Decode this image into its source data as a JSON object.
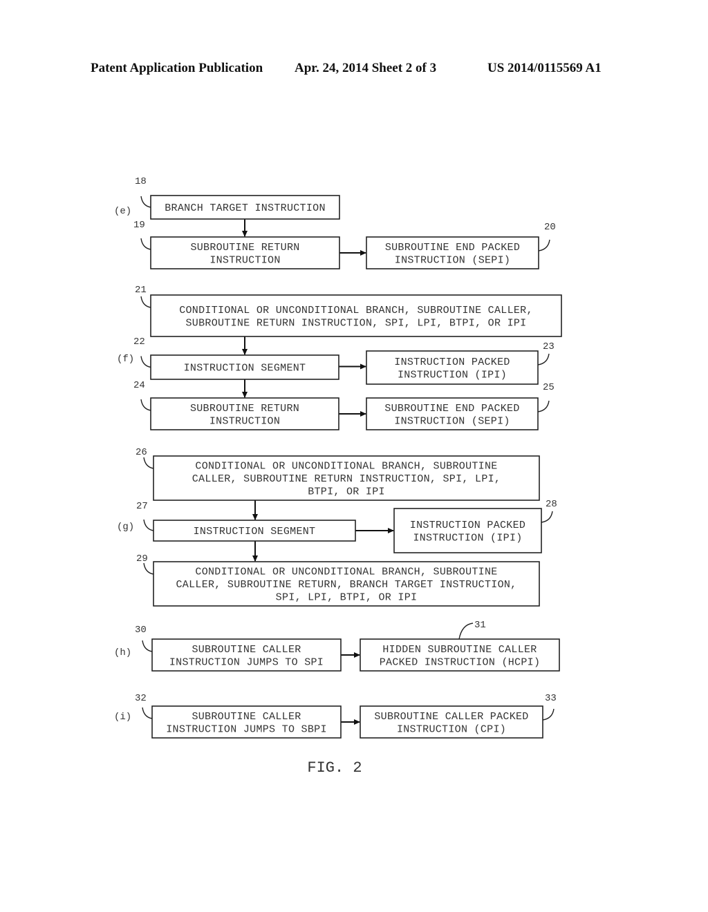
{
  "header": {
    "left": "Patent Application Publication",
    "center": "Apr. 24, 2014  Sheet 2 of 3",
    "right": "US 2014/0115569 A1"
  },
  "figure_caption": "FIG. 2",
  "sections": [
    {
      "label": "(e)"
    },
    {
      "label": "(f)"
    },
    {
      "label": "(g)"
    },
    {
      "label": "(h)"
    },
    {
      "label": "(i)"
    }
  ],
  "boxes": [
    {
      "ref": "18",
      "lines": [
        "BRANCH TARGET INSTRUCTION"
      ]
    },
    {
      "ref": "19",
      "lines": [
        "SUBROUTINE RETURN",
        "INSTRUCTION"
      ]
    },
    {
      "ref": "20",
      "lines": [
        "SUBROUTINE END PACKED",
        "INSTRUCTION (SEPI)"
      ]
    },
    {
      "ref": "21",
      "lines": [
        "CONDITIONAL OR UNCONDITIONAL BRANCH, SUBROUTINE CALLER,",
        "SUBROUTINE RETURN INSTRUCTION, SPI, LPI, BTPI, OR IPI"
      ]
    },
    {
      "ref": "22",
      "lines": [
        "INSTRUCTION SEGMENT"
      ]
    },
    {
      "ref": "23",
      "lines": [
        "INSTRUCTION PACKED",
        "INSTRUCTION (IPI)"
      ]
    },
    {
      "ref": "24",
      "lines": [
        "SUBROUTINE RETURN",
        "INSTRUCTION"
      ]
    },
    {
      "ref": "25",
      "lines": [
        "SUBROUTINE END PACKED",
        "INSTRUCTION (SEPI)"
      ]
    },
    {
      "ref": "26",
      "lines": [
        "CONDITIONAL OR UNCONDITIONAL BRANCH, SUBROUTINE",
        "CALLER, SUBROUTINE RETURN INSTRUCTION, SPI, LPI,",
        "BTPI, OR IPI"
      ]
    },
    {
      "ref": "27",
      "lines": [
        "INSTRUCTION SEGMENT"
      ]
    },
    {
      "ref": "28",
      "lines": [
        "INSTRUCTION PACKED",
        "INSTRUCTION (IPI)"
      ]
    },
    {
      "ref": "29",
      "lines": [
        "CONDITIONAL OR UNCONDITIONAL BRANCH, SUBROUTINE",
        "CALLER, SUBROUTINE RETURN, BRANCH TARGET INSTRUCTION,",
        "SPI, LPI, BTPI, OR IPI"
      ]
    },
    {
      "ref": "30",
      "lines": [
        "SUBROUTINE CALLER",
        "INSTRUCTION JUMPS TO SPI"
      ]
    },
    {
      "ref": "31",
      "lines": [
        "HIDDEN SUBROUTINE CALLER",
        "PACKED INSTRUCTION (HCPI)"
      ]
    },
    {
      "ref": "32",
      "lines": [
        "SUBROUTINE CALLER",
        "INSTRUCTION JUMPS TO SBPI"
      ]
    },
    {
      "ref": "33",
      "lines": [
        "SUBROUTINE CALLER PACKED",
        "INSTRUCTION (CPI)"
      ]
    }
  ],
  "connections": [
    {
      "from": "18",
      "to": "19"
    },
    {
      "from": "19",
      "to": "20"
    },
    {
      "from": "21",
      "to": "22"
    },
    {
      "from": "22",
      "to": "23"
    },
    {
      "from": "22",
      "to": "24"
    },
    {
      "from": "24",
      "to": "25"
    },
    {
      "from": "26",
      "to": "27"
    },
    {
      "from": "27",
      "to": "28"
    },
    {
      "from": "27",
      "to": "29"
    },
    {
      "from": "30",
      "to": "31"
    },
    {
      "from": "32",
      "to": "33"
    }
  ]
}
